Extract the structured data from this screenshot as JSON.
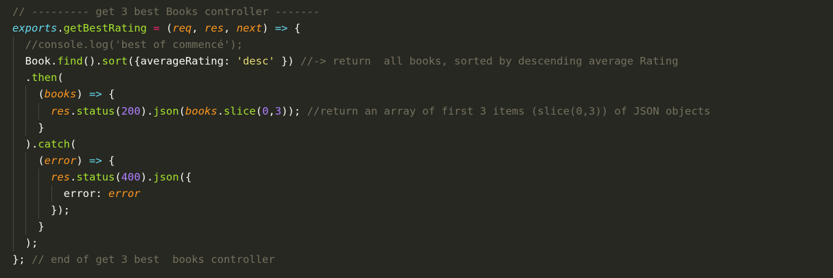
{
  "editor": {
    "language": "javascript",
    "theme_background": "#272822",
    "colors": {
      "comment": "#75715e",
      "object": "#66d9ef",
      "function": "#a6e22e",
      "operator": "#f92672",
      "parameter": "#fd971f",
      "string": "#e6db74",
      "number": "#ae81ff",
      "plain": "#f8f8f2"
    },
    "lines": [
      {
        "indent": 0,
        "tokens": [
          {
            "t": "comment",
            "v": "// --------- get 3 best Books controller -------"
          }
        ]
      },
      {
        "indent": 0,
        "tokens": [
          {
            "t": "obj",
            "v": "exports"
          },
          {
            "t": "plain",
            "v": "."
          },
          {
            "t": "fn",
            "v": "getBestRating"
          },
          {
            "t": "plain",
            "v": " "
          },
          {
            "t": "op",
            "v": "="
          },
          {
            "t": "plain",
            "v": " ("
          },
          {
            "t": "param",
            "v": "req"
          },
          {
            "t": "plain",
            "v": ", "
          },
          {
            "t": "param",
            "v": "res"
          },
          {
            "t": "plain",
            "v": ", "
          },
          {
            "t": "param",
            "v": "next"
          },
          {
            "t": "plain",
            "v": ") "
          },
          {
            "t": "arrow",
            "v": "=>"
          },
          {
            "t": "plain",
            "v": " {"
          }
        ]
      },
      {
        "indent": 1,
        "tokens": [
          {
            "t": "plain",
            "v": "  "
          },
          {
            "t": "comment",
            "v": "//console.log('best of commencé');"
          }
        ]
      },
      {
        "indent": 1,
        "tokens": [
          {
            "t": "plain",
            "v": "  Book."
          },
          {
            "t": "fn",
            "v": "find"
          },
          {
            "t": "plain",
            "v": "()."
          },
          {
            "t": "fn",
            "v": "sort"
          },
          {
            "t": "plain",
            "v": "({averageRating: "
          },
          {
            "t": "str",
            "v": "'desc'"
          },
          {
            "t": "plain",
            "v": " }) "
          },
          {
            "t": "comment",
            "v": "//-> return  all books, sorted by descending average Rating"
          }
        ]
      },
      {
        "indent": 1,
        "tokens": [
          {
            "t": "plain",
            "v": "  ."
          },
          {
            "t": "fn",
            "v": "then"
          },
          {
            "t": "plain",
            "v": "("
          }
        ]
      },
      {
        "indent": 2,
        "tokens": [
          {
            "t": "plain",
            "v": "    ("
          },
          {
            "t": "param",
            "v": "books"
          },
          {
            "t": "plain",
            "v": ") "
          },
          {
            "t": "arrow",
            "v": "=>"
          },
          {
            "t": "plain",
            "v": " {"
          }
        ]
      },
      {
        "indent": 3,
        "tokens": [
          {
            "t": "plain",
            "v": "      "
          },
          {
            "t": "param",
            "v": "res"
          },
          {
            "t": "plain",
            "v": "."
          },
          {
            "t": "fn",
            "v": "status"
          },
          {
            "t": "plain",
            "v": "("
          },
          {
            "t": "num",
            "v": "200"
          },
          {
            "t": "plain",
            "v": ")."
          },
          {
            "t": "fn",
            "v": "json"
          },
          {
            "t": "plain",
            "v": "("
          },
          {
            "t": "param",
            "v": "books"
          },
          {
            "t": "plain",
            "v": "."
          },
          {
            "t": "fn",
            "v": "slice"
          },
          {
            "t": "plain",
            "v": "("
          },
          {
            "t": "num",
            "v": "0"
          },
          {
            "t": "plain",
            "v": ","
          },
          {
            "t": "num",
            "v": "3"
          },
          {
            "t": "plain",
            "v": ")); "
          },
          {
            "t": "comment",
            "v": "//return an array of first 3 items (slice(0,3)) of JSON objects"
          }
        ]
      },
      {
        "indent": 2,
        "tokens": [
          {
            "t": "plain",
            "v": "    }"
          }
        ]
      },
      {
        "indent": 1,
        "tokens": [
          {
            "t": "plain",
            "v": "  )."
          },
          {
            "t": "fn",
            "v": "catch"
          },
          {
            "t": "plain",
            "v": "("
          }
        ]
      },
      {
        "indent": 2,
        "tokens": [
          {
            "t": "plain",
            "v": "    ("
          },
          {
            "t": "param",
            "v": "error"
          },
          {
            "t": "plain",
            "v": ") "
          },
          {
            "t": "arrow",
            "v": "=>"
          },
          {
            "t": "plain",
            "v": " {"
          }
        ]
      },
      {
        "indent": 3,
        "tokens": [
          {
            "t": "plain",
            "v": "      "
          },
          {
            "t": "param",
            "v": "res"
          },
          {
            "t": "plain",
            "v": "."
          },
          {
            "t": "fn",
            "v": "status"
          },
          {
            "t": "plain",
            "v": "("
          },
          {
            "t": "num",
            "v": "400"
          },
          {
            "t": "plain",
            "v": ")."
          },
          {
            "t": "fn",
            "v": "json"
          },
          {
            "t": "plain",
            "v": "({"
          }
        ]
      },
      {
        "indent": 4,
        "tokens": [
          {
            "t": "plain",
            "v": "        error: "
          },
          {
            "t": "param",
            "v": "error"
          }
        ]
      },
      {
        "indent": 3,
        "tokens": [
          {
            "t": "plain",
            "v": "      });"
          }
        ]
      },
      {
        "indent": 2,
        "tokens": [
          {
            "t": "plain",
            "v": "    }"
          }
        ]
      },
      {
        "indent": 1,
        "tokens": [
          {
            "t": "plain",
            "v": "  );"
          }
        ]
      },
      {
        "indent": 0,
        "tokens": [
          {
            "t": "plain",
            "v": "}; "
          },
          {
            "t": "comment",
            "v": "// end of get 3 best  books controller"
          }
        ]
      }
    ]
  }
}
